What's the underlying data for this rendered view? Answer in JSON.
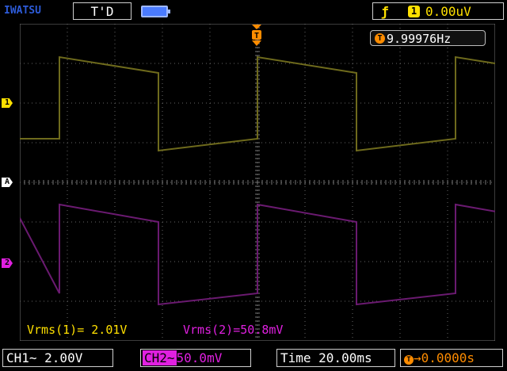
{
  "header": {
    "brand": "IWATSU",
    "trigger_mode": "T'D",
    "trigger_channel": "1",
    "trigger_level": "0.00uV",
    "colors": {
      "brand": "#2d5bd8",
      "ch1": "#ffe000",
      "ch2": "#e020e0",
      "trigger": "#ff8c00"
    }
  },
  "markers": {
    "ch1": "1",
    "acq": "A",
    "ch2": "2",
    "trigger": "T"
  },
  "frequency": {
    "icon": "T",
    "value": "9.99976Hz"
  },
  "measurements": {
    "ch1": "Vrms(1)= 2.01V",
    "ch2": "Vrms(2)=50.8mV"
  },
  "settings": {
    "ch1": "CH1∼ 2.00V",
    "ch2_tag": "CH2∼",
    "ch2_value": "50.0mV",
    "timebase": "Time 20.00ms",
    "delay_icon": "T",
    "delay": "→0.0000s"
  },
  "icons": {
    "battery": "battery-icon",
    "edge": "rising-edge-icon",
    "trigger_marker": "trigger-position-icon"
  },
  "waveform": {
    "period_divisions": 5,
    "time_per_div": "20.00ms"
  }
}
